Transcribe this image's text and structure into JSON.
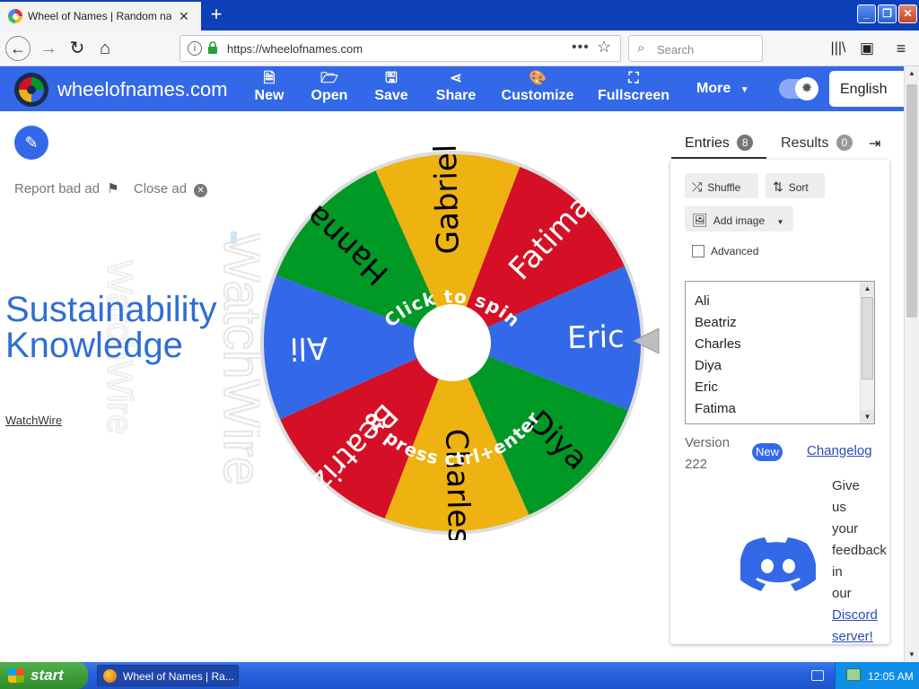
{
  "browser": {
    "tab_title": "Wheel of Names | Random name p",
    "tab_close": "✕",
    "new_tab": "+",
    "url": "https://wheelofnames.com",
    "search_placeholder": "Search"
  },
  "app": {
    "brand": "wheelofnames.com",
    "menu": [
      {
        "label": "New",
        "icon": "file-icon"
      },
      {
        "label": "Open",
        "icon": "folder-icon"
      },
      {
        "label": "Save",
        "icon": "save-icon"
      },
      {
        "label": "Share",
        "icon": "share-icon"
      },
      {
        "label": "Customize",
        "icon": "palette-icon"
      },
      {
        "label": "Fullscreen",
        "icon": "fullscreen-icon"
      }
    ],
    "more_label": "More",
    "language": "English"
  },
  "ad": {
    "report_label": "Report bad ad",
    "close_label": "Close ad",
    "headline_line1": "Sustainability",
    "headline_line2": "Knowledge",
    "advertiser": "WatchWire",
    "watermark": "WatchWire"
  },
  "wheel": {
    "top_text": "Click to spin",
    "bottom_text": "or press ctrl+enter",
    "slices": [
      {
        "name": "Eric",
        "color": "#3369e8"
      },
      {
        "name": "Diya",
        "color": "#009925"
      },
      {
        "name": "Charles",
        "color": "#eeb211"
      },
      {
        "name": "Beatriz",
        "color": "#d50f25"
      },
      {
        "name": "Ali",
        "color": "#3369e8"
      },
      {
        "name": "Hanna",
        "color": "#009925"
      },
      {
        "name": "Gabriel",
        "color": "#eeb211"
      },
      {
        "name": "Fatima",
        "color": "#d50f25"
      }
    ]
  },
  "sidebar": {
    "entries_tab": "Entries",
    "entries_count": "8",
    "results_tab": "Results",
    "results_count": "0",
    "shuffle": "Shuffle",
    "sort": "Sort",
    "add_image": "Add image",
    "advanced": "Advanced",
    "entries_list": [
      "Ali",
      "Beatriz",
      "Charles",
      "Diya",
      "Eric",
      "Fatima"
    ],
    "version_label": "Version",
    "version_number": "222",
    "new_badge": "New",
    "changelog": "Changelog",
    "feedback_words": [
      "Give",
      "us",
      "your",
      "feedback",
      "in",
      "our"
    ],
    "discord_link": "Discord server!"
  },
  "taskbar": {
    "start": "start",
    "task": "Wheel of Names | Ra...",
    "clock": "12:05 AM"
  },
  "colors": {
    "accent": "#3369e8",
    "green": "#009925",
    "yellow": "#eeb211",
    "red": "#d50f25"
  }
}
